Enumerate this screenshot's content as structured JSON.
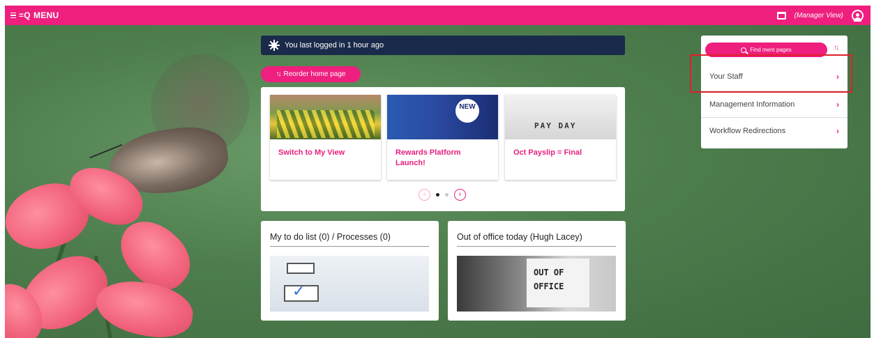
{
  "topbar": {
    "menu_label": "MENU",
    "menu_prefix": "=Q",
    "view_label": "(Manager View)",
    "bg_color": "#ee1f7e"
  },
  "login_banner": {
    "text": "You last logged in 1 hour ago",
    "icon": "sun-icon"
  },
  "reorder": {
    "label": "Reorder home page",
    "icon": "sort-arrows-icon"
  },
  "carousel": {
    "cards": [
      {
        "title": "Switch to My View",
        "image": "yellow-flowers"
      },
      {
        "title": "Rewards Platform Launch!",
        "image": "rewards-new-banner",
        "badge": "NEW"
      },
      {
        "title": "Oct Payslip = Final",
        "image": "pay-day-tiles",
        "image_text": "PAY DAY"
      }
    ],
    "prev_glyph": "‹",
    "next_glyph": "›",
    "active_index": 0,
    "page_count": 3
  },
  "panels": {
    "todo": {
      "title": "My to do list (0) / Processes (0)"
    },
    "out_of_office": {
      "title": "Out of office today (Hugh Lacey)",
      "image_text_1": "OUT OF",
      "image_text_2": "OFFICE"
    }
  },
  "side_menu": {
    "find_label": "Find ment pages",
    "items": [
      {
        "label": "Your Staff"
      },
      {
        "label": "Management Information"
      },
      {
        "label": "Workflow Redirections"
      }
    ],
    "chevron": "›",
    "highlight_color": "#e0202a"
  }
}
